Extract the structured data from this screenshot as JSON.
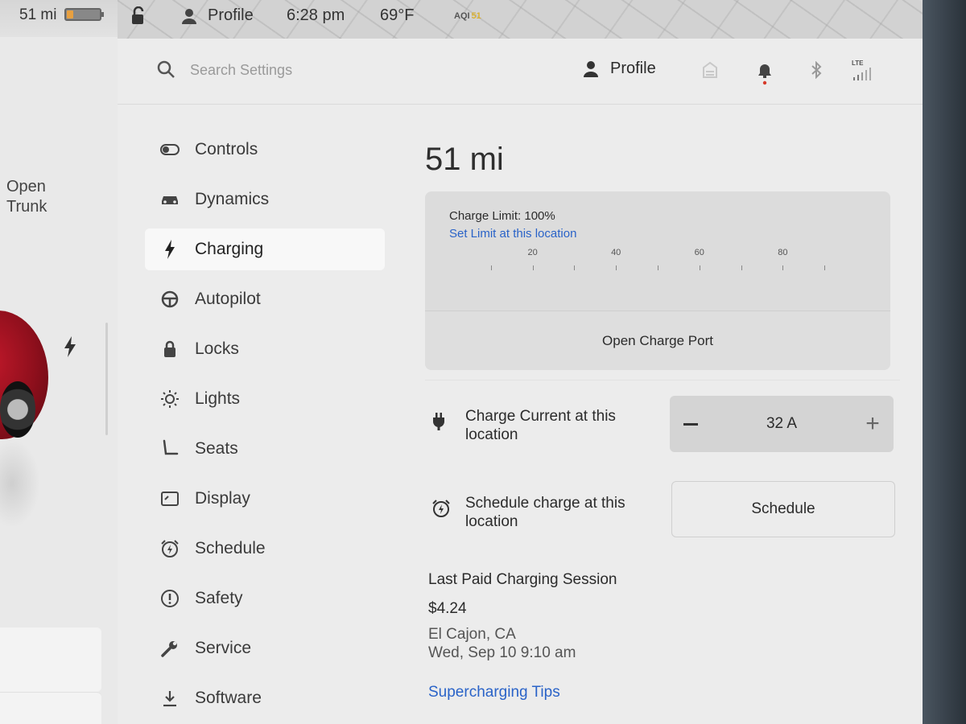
{
  "status_bar": {
    "range": "51 mi",
    "profile": "Profile",
    "time": "6:28 pm",
    "temperature": "69°F",
    "aqi_label": "AQI",
    "aqi_value": "51",
    "battery_level": 0.2
  },
  "car_panel": {
    "open_trunk_line1": "Open",
    "open_trunk_line2": "Trunk"
  },
  "header": {
    "search_placeholder": "Search Settings",
    "profile_label": "Profile",
    "signal_label": "LTE"
  },
  "sidebar": {
    "items": [
      {
        "label": "Controls",
        "icon": "toggle-icon"
      },
      {
        "label": "Dynamics",
        "icon": "car-icon"
      },
      {
        "label": "Charging",
        "icon": "bolt-icon",
        "active": true
      },
      {
        "label": "Autopilot",
        "icon": "steering-wheel-icon"
      },
      {
        "label": "Locks",
        "icon": "lock-icon"
      },
      {
        "label": "Lights",
        "icon": "light-icon"
      },
      {
        "label": "Seats",
        "icon": "seat-icon"
      },
      {
        "label": "Display",
        "icon": "display-icon"
      },
      {
        "label": "Schedule",
        "icon": "alarm-clock-icon"
      },
      {
        "label": "Safety",
        "icon": "alert-circle-icon"
      },
      {
        "label": "Service",
        "icon": "wrench-icon"
      },
      {
        "label": "Software",
        "icon": "download-icon"
      }
    ]
  },
  "charging": {
    "range": "51 mi",
    "charge_limit_label": "Charge Limit: 100%",
    "charge_limit_percent": 100,
    "current_charge_percent": 20,
    "set_limit_link": "Set Limit at this location",
    "tick_labels": [
      "20",
      "40",
      "60",
      "80"
    ],
    "open_port_label": "Open Charge Port",
    "current_label": "Charge Current at this location",
    "current_value": "32 A",
    "schedule_label": "Schedule charge at this location",
    "schedule_button": "Schedule",
    "last_session_title": "Last Paid Charging Session",
    "last_session_amount": "$4.24",
    "last_session_place": "El Cajon, CA",
    "last_session_time": "Wed, Sep 10 9:10 am",
    "tips_link": "Supercharging Tips"
  },
  "colors": {
    "accent_orange": "#f09a1c",
    "link_blue": "#2a63c8",
    "notification_red": "#d63a2a"
  }
}
